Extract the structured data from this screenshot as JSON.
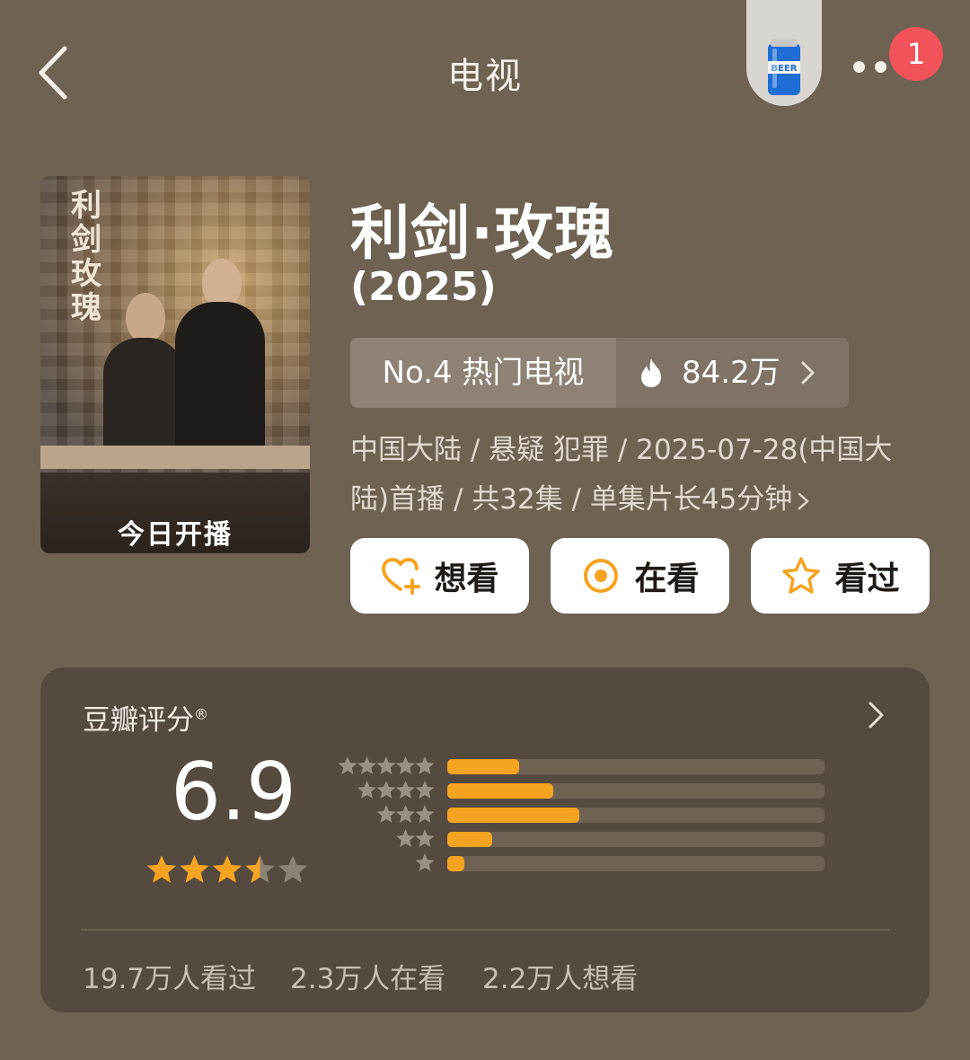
{
  "header": {
    "title": "电视",
    "badge_count": "1"
  },
  "poster": {
    "vertical_title": "利剑玫瑰",
    "caption": "今日开播"
  },
  "show": {
    "title": "利剑·玫瑰",
    "year": "(2025)"
  },
  "ranking": {
    "rank_label": "No.4 热门电视",
    "heat_value": "84.2万"
  },
  "meta": {
    "line1": "中国大陆 / 悬疑 犯罪 / 2025-07-28(中国大",
    "line2": "陆)首播 / 共32集 / 单集片长45分钟"
  },
  "actions": {
    "want": "想看",
    "watching": "在看",
    "watched": "看过"
  },
  "rating": {
    "title": "豆瓣评分",
    "title_mark": "®",
    "score": "6.9",
    "stars": 3.5,
    "distribution": [
      {
        "stars": 5,
        "fraction": 0.19
      },
      {
        "stars": 4,
        "fraction": 0.28
      },
      {
        "stars": 3,
        "fraction": 0.35
      },
      {
        "stars": 2,
        "fraction": 0.12
      },
      {
        "stars": 1,
        "fraction": 0.045
      }
    ]
  },
  "stats": {
    "watched": "19.7万人看过",
    "watching": "2.3万人在看",
    "want": "2.2万人想看"
  },
  "colors": {
    "background": "#6e6253",
    "card": "#554a3f",
    "accent": "#f5a422",
    "badge": "#f2535b"
  },
  "icons": [
    "back-arrow-icon",
    "beer-can-icon",
    "more-dots-icon",
    "flame-icon",
    "chevron-right-icon",
    "heart-plus-icon",
    "target-circle-icon",
    "star-outline-icon"
  ]
}
